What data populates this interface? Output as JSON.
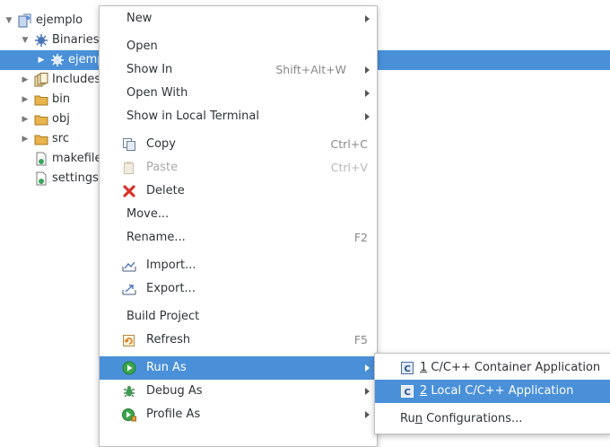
{
  "tree": {
    "items": [
      {
        "label": "ejemplo",
        "icon": "project-icon"
      },
      {
        "label": "Binaries",
        "icon": "binaries-icon"
      },
      {
        "label": "ejemp",
        "icon": "executable-icon"
      },
      {
        "label": "Includes",
        "icon": "includes-icon"
      },
      {
        "label": "bin",
        "icon": "folder-icon"
      },
      {
        "label": "obj",
        "icon": "folder-icon"
      },
      {
        "label": "src",
        "icon": "folder-icon"
      },
      {
        "label": "makefile",
        "icon": "makefile-icon"
      },
      {
        "label": "settings.m",
        "icon": "makefile-icon"
      }
    ]
  },
  "context_menu": {
    "items": [
      {
        "label": "New"
      },
      {
        "label": "Open"
      },
      {
        "label": "Show In",
        "shortcut": "Shift+Alt+W"
      },
      {
        "label": "Open With"
      },
      {
        "label": "Show in Local Terminal"
      },
      {
        "label": "Copy",
        "shortcut": "Ctrl+C",
        "icon": "copy-icon"
      },
      {
        "label": "Paste",
        "shortcut": "Ctrl+V",
        "icon": "paste-icon"
      },
      {
        "label": "Delete",
        "icon": "delete-icon"
      },
      {
        "label": "Move..."
      },
      {
        "label": "Rename...",
        "shortcut": "F2"
      },
      {
        "label": "Import...",
        "icon": "import-icon"
      },
      {
        "label": "Export...",
        "icon": "export-icon"
      },
      {
        "label": "Build Project"
      },
      {
        "label": "Refresh",
        "shortcut": "F5",
        "icon": "refresh-icon"
      },
      {
        "label": "Run As",
        "icon": "run-icon"
      },
      {
        "label": "Debug As",
        "icon": "debug-icon"
      },
      {
        "label": "Profile As",
        "icon": "profile-icon"
      }
    ]
  },
  "submenu": {
    "items": [
      {
        "mnemonic": "1",
        "label": " C/C++ Container Application",
        "icon": "c-app-icon"
      },
      {
        "mnemonic": "2",
        "label": " Local C/C++ Application",
        "icon": "c-app-icon"
      },
      {
        "pre": "Ru",
        "mnemonic": "n",
        "label": " Configurations..."
      }
    ]
  },
  "colors": {
    "selection": "#4a90d9",
    "folder": "#e9b44c"
  }
}
